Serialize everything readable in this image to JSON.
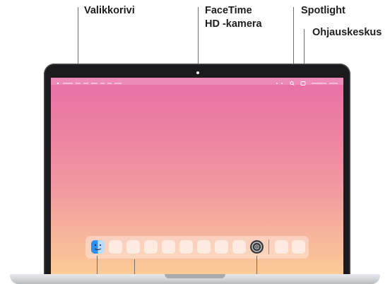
{
  "callouts": {
    "menubar": "Valikkorivi",
    "camera_line1": "FaceTime",
    "camera_line2": "HD -kamera",
    "spotlight": "Spotlight",
    "control_center": "Ohjauskeskus"
  },
  "icons": {
    "finder": "finder-icon",
    "settings": "settings-gear-icon",
    "spotlight": "search-icon",
    "control_center": "control-center-icon"
  },
  "colors": {
    "wallpaper_top": "#e771a6",
    "wallpaper_bottom": "#fbcb95",
    "bezel": "#1b1b1d",
    "finder_blue": "#2f8ff0"
  }
}
